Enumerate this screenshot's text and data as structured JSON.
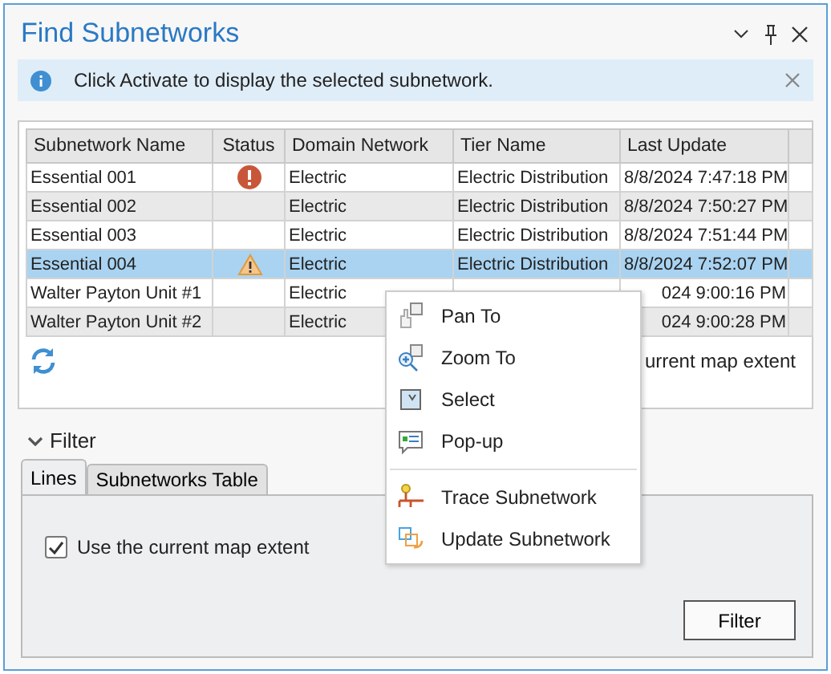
{
  "window": {
    "title": "Find Subnetworks"
  },
  "info_bar": {
    "message": "Click Activate to display the selected subnetwork."
  },
  "table": {
    "columns": [
      "Subnetwork Name",
      "Status",
      "Domain Network",
      "Tier Name",
      "Last Update"
    ],
    "rows": [
      {
        "name": "Essential 001",
        "kind": "error",
        "domain": "Electric",
        "tier": "Electric Distribution",
        "update": "8/8/2024 7:47:18 PM",
        "selected": false
      },
      {
        "name": "Essential 002",
        "kind": "plain",
        "domain": "Electric",
        "tier": "Electric Distribution",
        "update": "8/8/2024 7:50:27 PM",
        "selected": false
      },
      {
        "name": "Essential 003",
        "kind": "plain",
        "domain": "Electric",
        "tier": "Electric Distribution",
        "update": "8/8/2024 7:51:44 PM",
        "selected": false
      },
      {
        "name": "Essential 004",
        "kind": "warning",
        "domain": "Electric",
        "tier": "Electric Distribution",
        "update": "8/8/2024 7:52:07 PM",
        "selected": true
      },
      {
        "name": "Walter Payton Unit #1",
        "kind": "plain",
        "domain": "Electric",
        "update": "024 9:00:16 PM",
        "selected": false
      },
      {
        "name": "Walter Payton Unit #2",
        "kind": "plain",
        "domain": "Electric",
        "update": "024 9:00:28 PM",
        "selected": false
      }
    ]
  },
  "extent_label": "urrent map extent",
  "filter": {
    "title": "Filter",
    "expanded": true,
    "tabs": [
      {
        "label": "Lines",
        "selected": true
      },
      {
        "label": "Subnetworks Table",
        "selected": false
      }
    ],
    "checkbox": {
      "label": "Use the current map extent",
      "checked": true
    },
    "button": "Filter"
  },
  "context_menu": [
    {
      "kind": "pan",
      "label": "Pan To"
    },
    {
      "kind": "zoom",
      "label": "Zoom To"
    },
    {
      "kind": "select",
      "label": "Select"
    },
    {
      "kind": "popup",
      "label": "Pop-up"
    },
    {
      "kind": "separator"
    },
    {
      "kind": "trace",
      "label": "Trace Subnetwork"
    },
    {
      "kind": "update",
      "label": "Update Subnetwork"
    }
  ]
}
